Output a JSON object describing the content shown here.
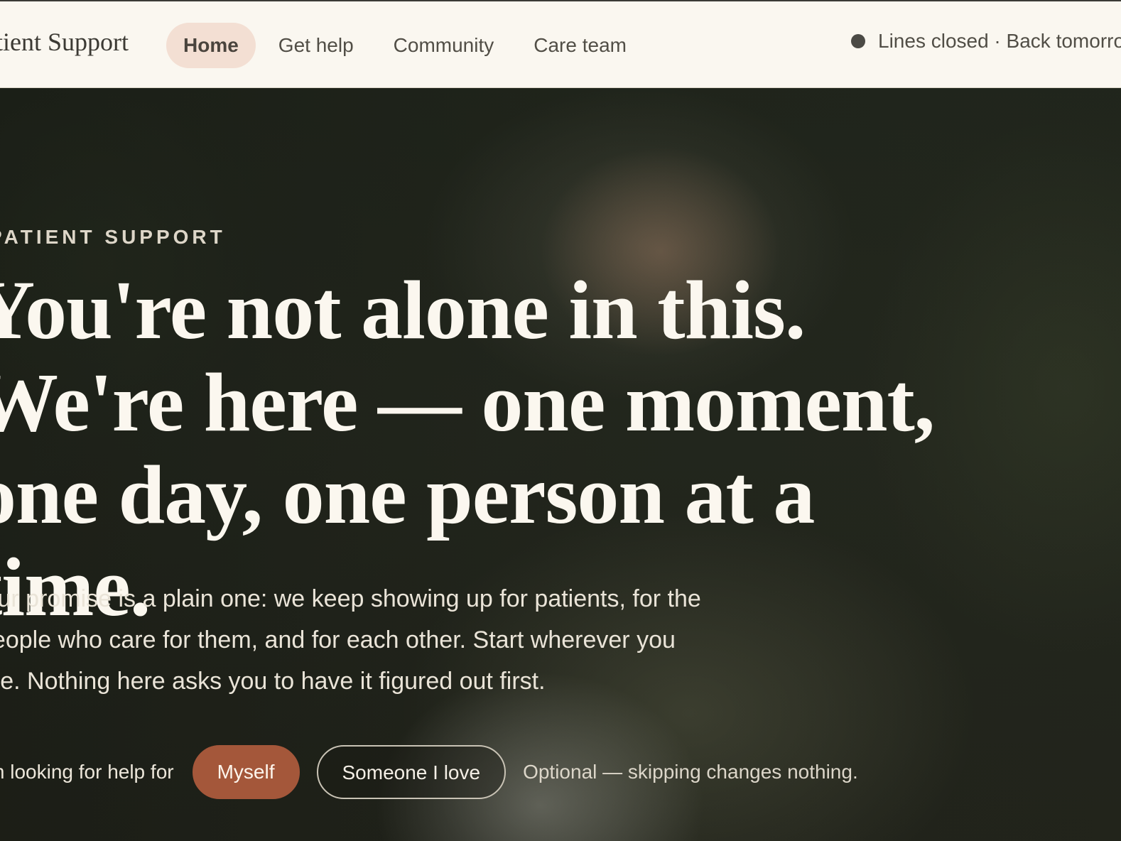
{
  "header": {
    "brand": "Patient Support",
    "nav": [
      {
        "label": "Home",
        "active": true
      },
      {
        "label": "Get help",
        "active": false
      },
      {
        "label": "Community",
        "active": false
      },
      {
        "label": "Care team",
        "active": false
      }
    ],
    "status": "Lines closed · Back tomorrow"
  },
  "hero": {
    "eyebrow": "PATIENT SUPPORT",
    "headline": "You're not alone in this. We're here — one moment, one day, one person at a time.",
    "lede": "Our promise is a plain one: we keep showing up for patients, for the people who care for them, and for each other. Start wherever you are. Nothing here asks you to have it figured out first.",
    "cta": {
      "label": "I'm looking for help for",
      "primary": "Myself",
      "secondary": "Someone I love",
      "note": "Optional — skipping changes nothing."
    }
  },
  "colors": {
    "accent": "#a4573a",
    "nav_active_bg": "#f3dfd3",
    "topbar_bg": "#faf7f0",
    "status_dot": "#4b4a45"
  },
  "icons": {
    "status": "status-dot-icon"
  }
}
